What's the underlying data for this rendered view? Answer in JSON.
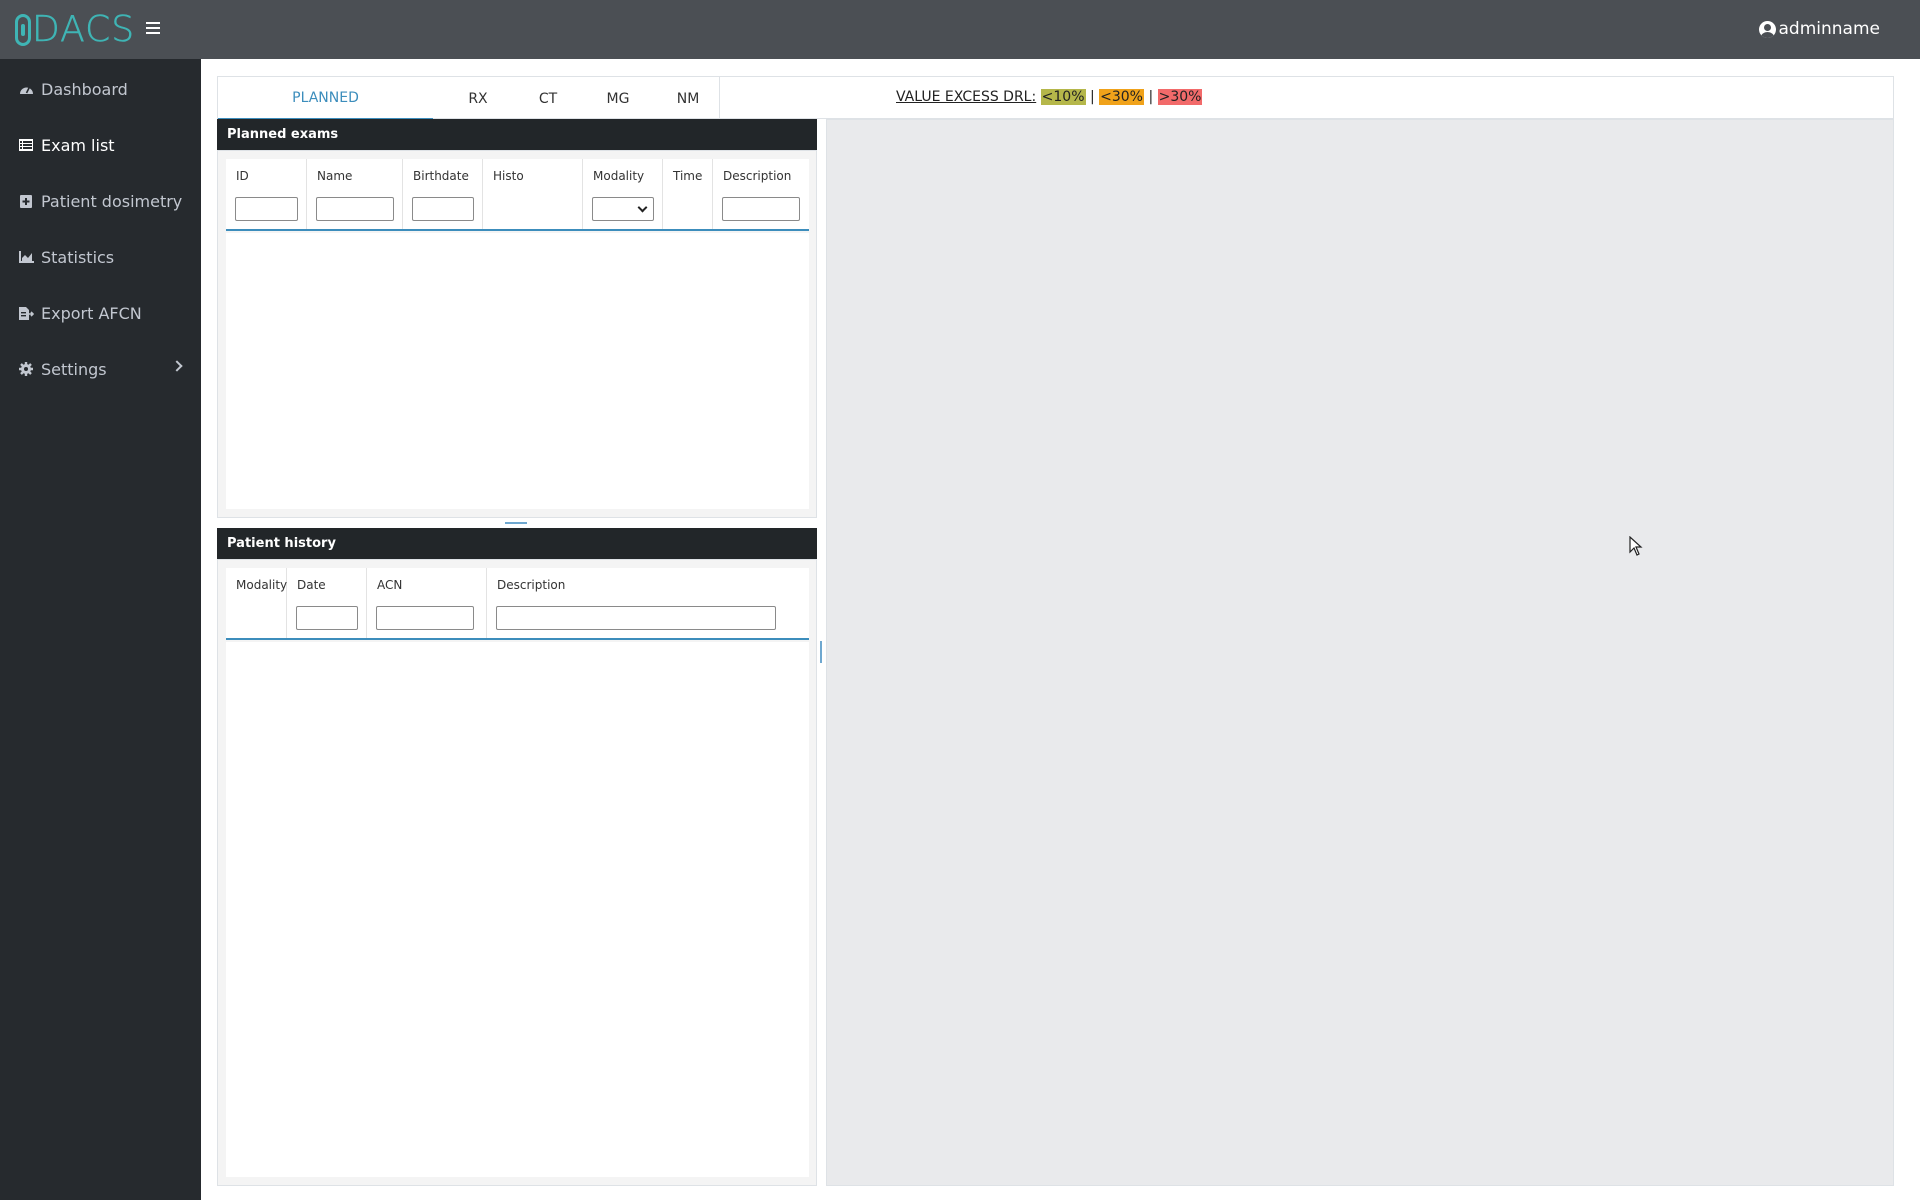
{
  "app": {
    "logo_text": "DACS",
    "user": "adminname"
  },
  "sidebar": {
    "items": [
      {
        "label": "Dashboard",
        "icon": "dashboard-icon"
      },
      {
        "label": "Exam list",
        "icon": "list-icon",
        "active": true
      },
      {
        "label": "Patient dosimetry",
        "icon": "dosimetry-icon"
      },
      {
        "label": "Statistics",
        "icon": "chart-icon"
      },
      {
        "label": "Export AFCN",
        "icon": "export-file-icon"
      },
      {
        "label": "Settings",
        "icon": "gear-icon"
      }
    ]
  },
  "tabs": [
    {
      "label": "PLANNED",
      "active": true
    },
    {
      "label": "RX"
    },
    {
      "label": "CT"
    },
    {
      "label": "MG"
    },
    {
      "label": "NM"
    }
  ],
  "drl": {
    "label": "VALUE EXCESS DRL:",
    "sep": "|",
    "levels": [
      {
        "label": "<10%",
        "color": "#b5b74a"
      },
      {
        "label": "<30%",
        "color": "#f0a21a"
      },
      {
        "label": ">30%",
        "color": "#f26a6a"
      }
    ]
  },
  "planned": {
    "title": "Planned exams",
    "columns": [
      "ID",
      "Name",
      "Birthdate",
      "Histo",
      "Modality",
      "Time",
      "Description"
    ]
  },
  "history": {
    "title": "Patient history",
    "columns": [
      "Modality",
      "Date",
      "ACN",
      "Description"
    ]
  },
  "colors": {
    "accent": "#3c8dbc",
    "sidebar": "#262a2e",
    "topbar": "#4b4f54",
    "logo": "#3fb5b5"
  }
}
